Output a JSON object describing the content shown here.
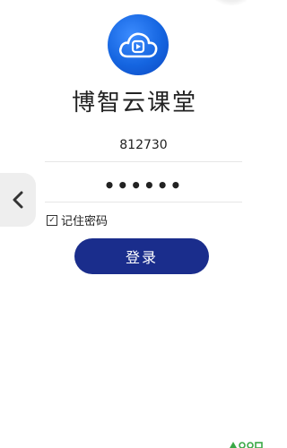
{
  "app": {
    "title": "博智云课堂"
  },
  "login": {
    "account_value": "812730",
    "password_masked": "••••••",
    "remember_label": "记住密码",
    "remember_checked": true,
    "login_button_label": "登录"
  },
  "colors": {
    "primary": "#1a2d8c",
    "logo_blue": "#1565e0",
    "watermark_green": "#3aa846"
  },
  "icons": {
    "logo": "cloud-play-logo-icon",
    "back": "chevron-left-icon",
    "watermark": "brand-watermark-icon"
  }
}
